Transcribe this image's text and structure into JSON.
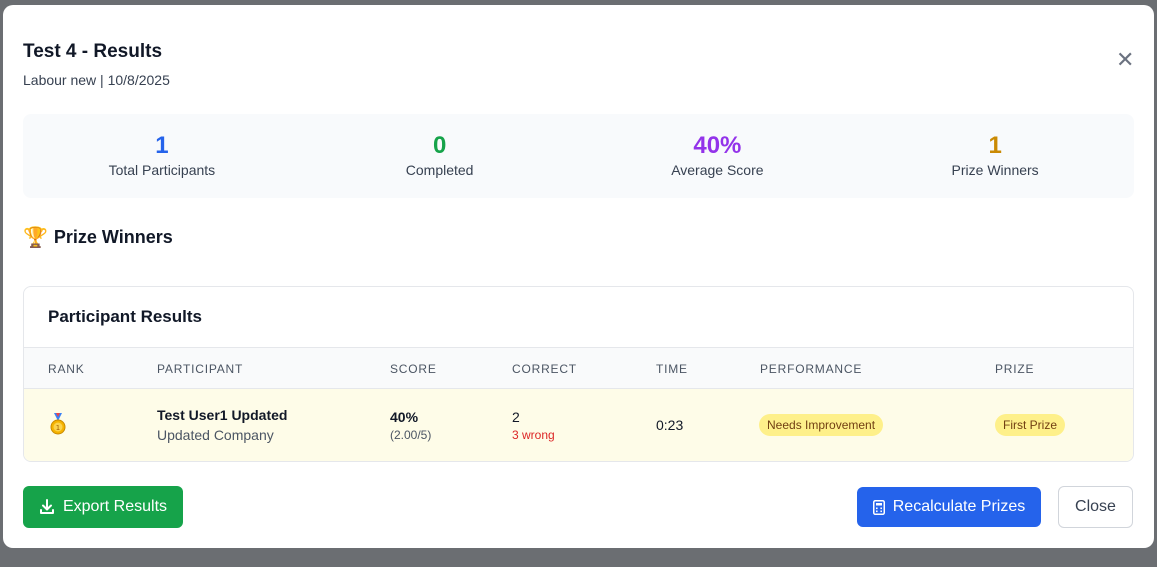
{
  "modal": {
    "title": "Test 4 - Results",
    "subtitle": "Labour new | 10/8/2025"
  },
  "stats": [
    {
      "value": "1",
      "label": "Total Participants",
      "color": "#2563eb"
    },
    {
      "value": "0",
      "label": "Completed",
      "color": "#16a34a"
    },
    {
      "value": "40%",
      "label": "Average Score",
      "color": "#9333ea"
    },
    {
      "value": "1",
      "label": "Prize Winners",
      "color": "#ca8a04"
    }
  ],
  "prize_section": {
    "icon": "trophy-icon",
    "title": "Prize Winners"
  },
  "results": {
    "title": "Participant Results",
    "columns": [
      "RANK",
      "PARTICIPANT",
      "SCORE",
      "CORRECT",
      "TIME",
      "PERFORMANCE",
      "PRIZE"
    ],
    "rows": [
      {
        "rank_icon": "medal-icon",
        "name": "Test User1 Updated",
        "company": "Updated Company",
        "score": "40%",
        "score_detail": "(2.00/5)",
        "correct": "2",
        "wrong": "3 wrong",
        "time": "0:23",
        "performance": "Needs Improvement",
        "prize": "First Prize"
      }
    ]
  },
  "buttons": {
    "export": "Export Results",
    "recalculate": "Recalculate Prizes",
    "close": "Close"
  }
}
